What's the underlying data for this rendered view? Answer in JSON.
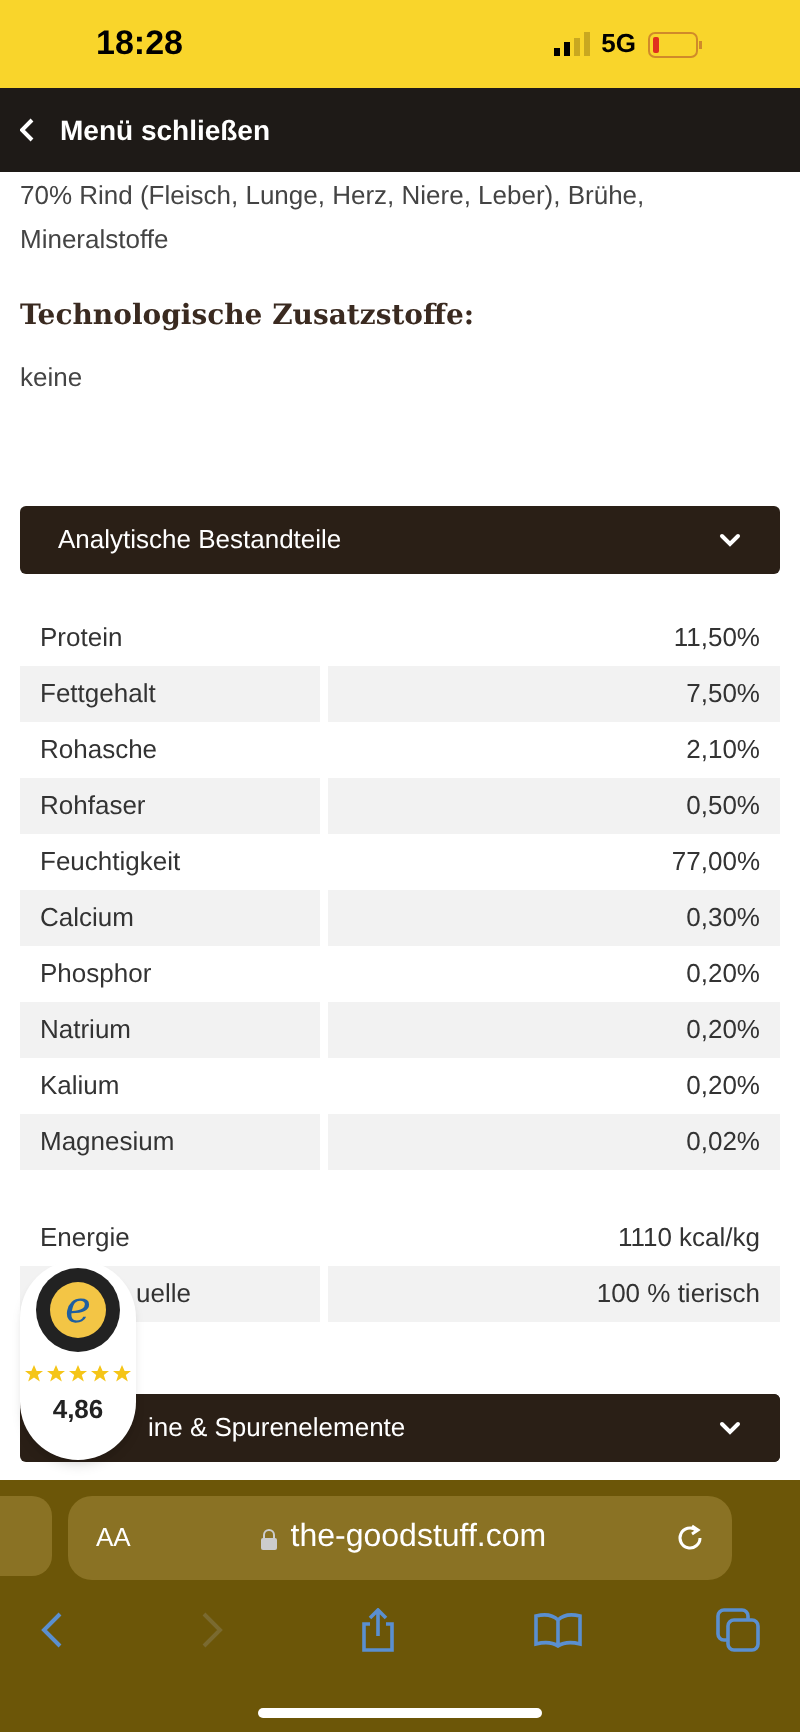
{
  "status_bar": {
    "time": "18:28",
    "network": "5G",
    "battery_low": true
  },
  "nav": {
    "back_label": "Menü schließen"
  },
  "composition": {
    "text": "70% Rind (Fleisch, Lunge, Herz, Niere, Leber), Brühe, Mineralstoffe"
  },
  "additives": {
    "heading": "Technologische Zusatzstoffe:",
    "text": "keine"
  },
  "accordions": [
    {
      "title": "Analytische Bestandteile"
    }
  ],
  "analytics": [
    {
      "name": "Protein",
      "value": "11,50%"
    },
    {
      "name": "Fettgehalt",
      "value": "7,50%"
    },
    {
      "name": "Rohasche",
      "value": "2,10%"
    },
    {
      "name": "Rohfaser",
      "value": "0,50%"
    },
    {
      "name": "Feuchtigkeit",
      "value": "77,00%"
    },
    {
      "name": "Calcium",
      "value": "0,30%"
    },
    {
      "name": "Phosphor",
      "value": "0,20%"
    },
    {
      "name": "Natrium",
      "value": "0,20%"
    },
    {
      "name": "Kalium",
      "value": "0,20%"
    },
    {
      "name": "Magnesium",
      "value": "0,02%"
    }
  ],
  "energy": [
    {
      "name": "Energie",
      "value": "1110 kcal/kg"
    },
    {
      "name": "uelle",
      "value": "100 % tierisch"
    }
  ],
  "accordion_partial": {
    "title": "ine & Spurenelemente",
    "expanded": false
  },
  "trust_badge": {
    "logo_letter": "e",
    "stars": 5,
    "rating": "4,86"
  },
  "browser": {
    "text_size": "AA",
    "url": "the-goodstuff.com",
    "back_enabled": true,
    "forward_enabled": false
  }
}
